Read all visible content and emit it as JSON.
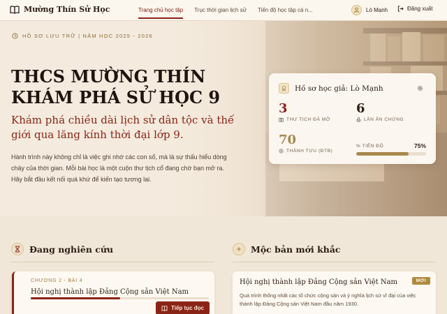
{
  "header": {
    "brand": "Mường Thín Sử Học",
    "nav": [
      {
        "label": "Trang chủ học tập",
        "active": true
      },
      {
        "label": "Trục thời gian lịch sử",
        "active": false
      },
      {
        "label": "Tiến độ học tập cá n...",
        "active": false
      }
    ],
    "user_name": "Lò Mạnh",
    "logout_label": "Đăng xuất"
  },
  "hero": {
    "archive_label": "HỒ SƠ LƯU TRỮ | NĂM HỌC 2025 - 2026",
    "title": "THCS MƯỜNG THÍN KHÁM PHÁ SỬ HỌC 9",
    "subtitle": "Khám phá chiều dài lịch sử dân tộc và thế giới qua lăng kính thời đại lớp 9.",
    "description": "Hành trình này không chỉ là việc ghi nhớ các con số, mà là sự thấu hiểu dòng chảy của thời gian. Mỗi bài học là một cuộn thư tịch cổ đang chờ bạn mở ra. Hãy bắt đầu kết nối quá khứ để kiến tạo tương lai."
  },
  "profile": {
    "title": "Hồ sơ học giả: Lò Mạnh",
    "stats": [
      {
        "value": "3",
        "label": "THƯ TỊCH ĐÃ MỞ",
        "icon": "book-icon",
        "color": "#8a2417"
      },
      {
        "value": "6",
        "label": "LẦN ẤN CHỨNG",
        "icon": "stamp-icon",
        "color": "#2b1d14"
      },
      {
        "value": "70",
        "label": "THÀNH TỰU (ĐTB)",
        "icon": "medal-icon",
        "color": "#a8884c"
      }
    ],
    "progress": {
      "label": "% TIẾN ĐỘ",
      "value": "75%",
      "fraction": 0.75
    }
  },
  "researching": {
    "title": "Đang nghiên cứu",
    "chapter": "CHƯƠNG 2 - BÀI 4",
    "lesson": "Hội nghị thành lập Đảng Cộng sản Việt Nam",
    "lesson_progress": 0.5,
    "continue_label": "Tiếp tục đọc"
  },
  "new_blocks": {
    "title": "Mộc bản mới khắc",
    "item_title": "Hội nghị thành lập Đảng Cộng sản Việt Nam",
    "badge": "MỚI",
    "item_desc": "Quá trình thống nhất các tổ chức cộng sản và ý nghĩa lịch sử vĩ đại của việc thành lập Đảng Cộng sản Việt Nam đầu năm 1930."
  },
  "colors": {
    "accent": "#8a2417",
    "gold": "#a8884c",
    "paper": "#fbf7f0"
  }
}
